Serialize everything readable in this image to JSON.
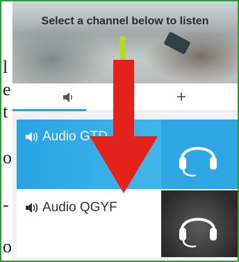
{
  "banner": {
    "title": "Select a channel below to listen"
  },
  "tabs": [
    {
      "icon": "speaker-icon",
      "active": true
    },
    {
      "label": "+"
    }
  ],
  "channels": [
    {
      "label": "Audio GTD",
      "icon": "speaker-icon",
      "thumbnail": "headphones-icon",
      "selected": true
    },
    {
      "label": "Audio QGYF",
      "icon": "speaker-icon",
      "thumbnail": "headphones-icon",
      "selected": false
    }
  ],
  "left_fragments": [
    "l",
    "e",
    "t",
    "o",
    "-",
    "o"
  ],
  "colors": {
    "accent": "#1ea8e0",
    "selected_row": "#29a3e2",
    "overlay_arrow": "#e5211c",
    "frame_border": "#2e9a3a"
  }
}
